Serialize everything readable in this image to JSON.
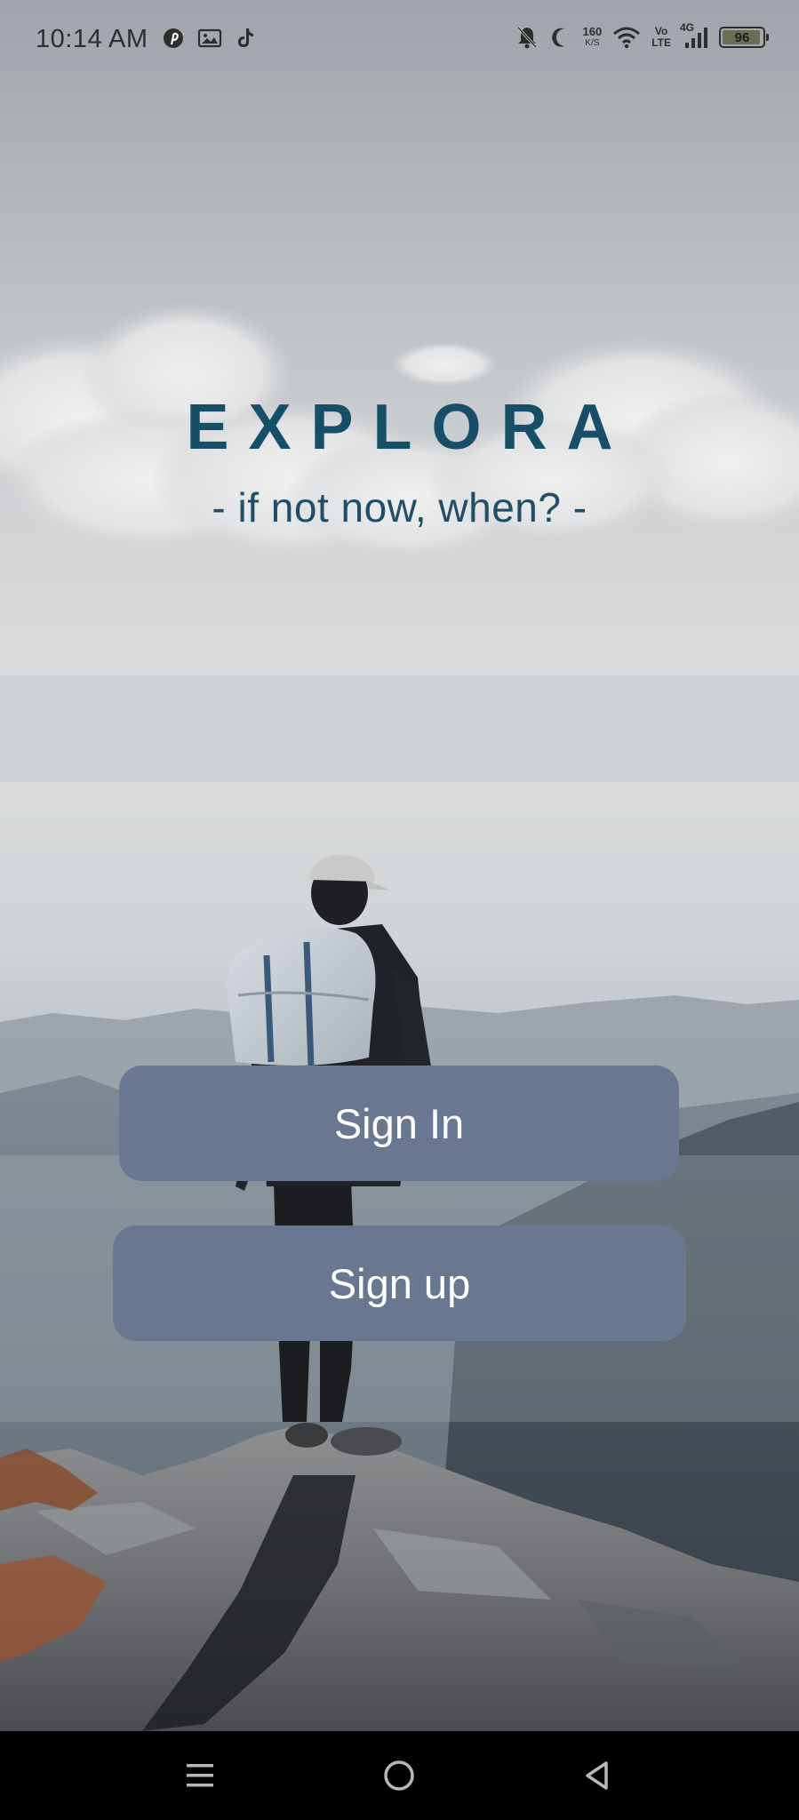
{
  "status_bar": {
    "time": "10:14 AM",
    "left_icons": [
      "pinterest-icon",
      "gallery-notification-icon",
      "tiktok-icon"
    ],
    "right_icons": [
      "bell-muted-icon",
      "moon-icon",
      "net-speed",
      "wifi-icon",
      "volte",
      "signal-icon",
      "battery-icon"
    ],
    "net_speed_value": "160",
    "net_speed_unit": "K/S",
    "volte_top": "Vo",
    "volte_bottom": "LTE",
    "network_type": "4G",
    "battery_level": "96",
    "battery_fraction": 0.96
  },
  "brand": {
    "title": "EXPLORA",
    "tagline": "- if not now, when? -",
    "title_color": "#174f68"
  },
  "actions": {
    "sign_in_label": "Sign In",
    "sign_up_label": "Sign up",
    "button_color": "#6a7790"
  },
  "nav_bar": {
    "icons": [
      "menu-icon",
      "home-icon",
      "back-icon"
    ]
  }
}
